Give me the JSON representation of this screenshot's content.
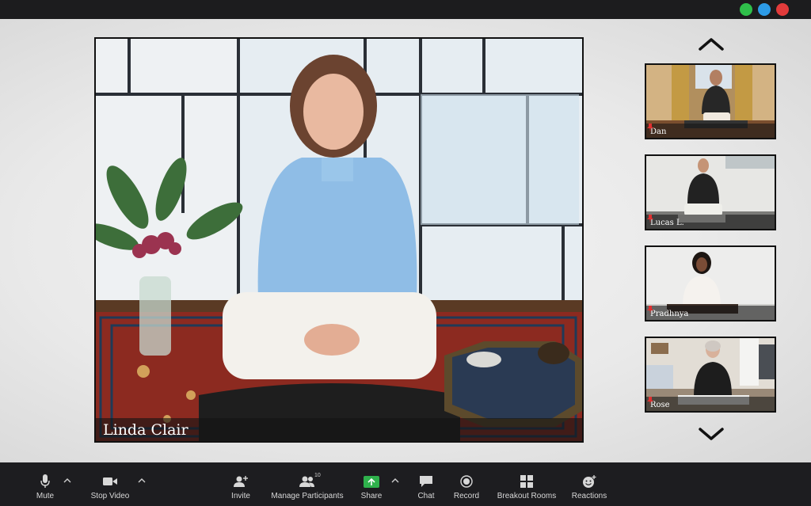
{
  "window": {
    "controls": [
      {
        "name": "green-window-button",
        "color": "#2fbf4a"
      },
      {
        "name": "blue-window-button",
        "color": "#2d9be6"
      },
      {
        "name": "red-window-button",
        "color": "#e23b3b"
      }
    ]
  },
  "main_speaker": {
    "name": "Linda Clair"
  },
  "participants": [
    {
      "name": "Dan",
      "pinned": true
    },
    {
      "name": "Lucas L.",
      "pinned": true
    },
    {
      "name": "Pradhnya",
      "pinned": true
    },
    {
      "name": "Rose",
      "pinned": true
    }
  ],
  "navigation": {
    "scroll_up_icon": "chevron-up-icon",
    "scroll_down_icon": "chevron-down-icon"
  },
  "toolbar": {
    "mute_label": "Mute",
    "stop_video_label": "Stop Video",
    "invite_label": "Invite",
    "manage_participants_label": "Manage Participants",
    "participants_count": "10",
    "share_label": "Share",
    "chat_label": "Chat",
    "record_label": "Record",
    "breakout_rooms_label": "Breakout Rooms",
    "reactions_label": "Reactions",
    "share_accent": "#2fb14c"
  }
}
